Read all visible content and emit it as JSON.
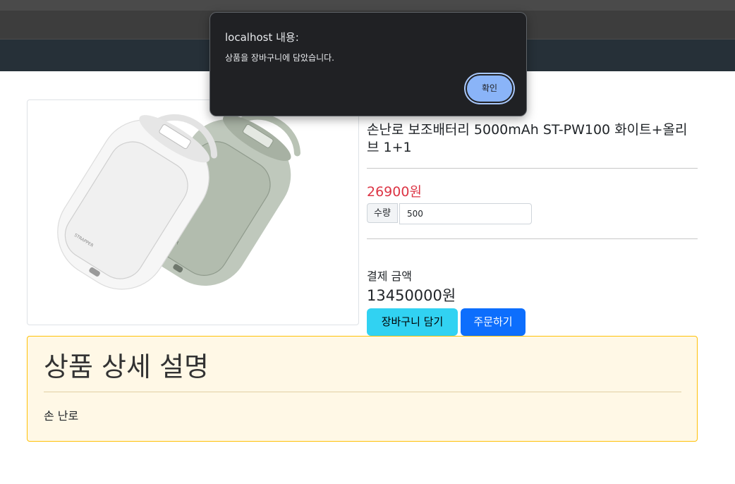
{
  "dialog": {
    "title": "localhost 내용:",
    "message": "상품을 장바구니에 담았습니다.",
    "ok_label": "확인"
  },
  "product": {
    "title": "손난로 보조배터리 5000mAh ST-PW100 화이트+올리브 1+1",
    "price": "26900원",
    "quantity_label": "수량",
    "quantity_value": "500",
    "payment_label": "결제 금액",
    "payment_amount": "13450000원",
    "brand_mark": "STRAPPER",
    "cart_button": "장바구니 담기",
    "order_button": "주문하기"
  },
  "detail": {
    "title": "상품 상세 설명",
    "body": "손 난로"
  },
  "colors": {
    "price": "#dc3545",
    "cart_button": "#31d2f2",
    "order_button": "#0d6efd",
    "detail_background": "#fff8e6",
    "detail_border": "#ffc107",
    "dialog_background": "#202124",
    "dialog_button": "#8ab4f8"
  }
}
